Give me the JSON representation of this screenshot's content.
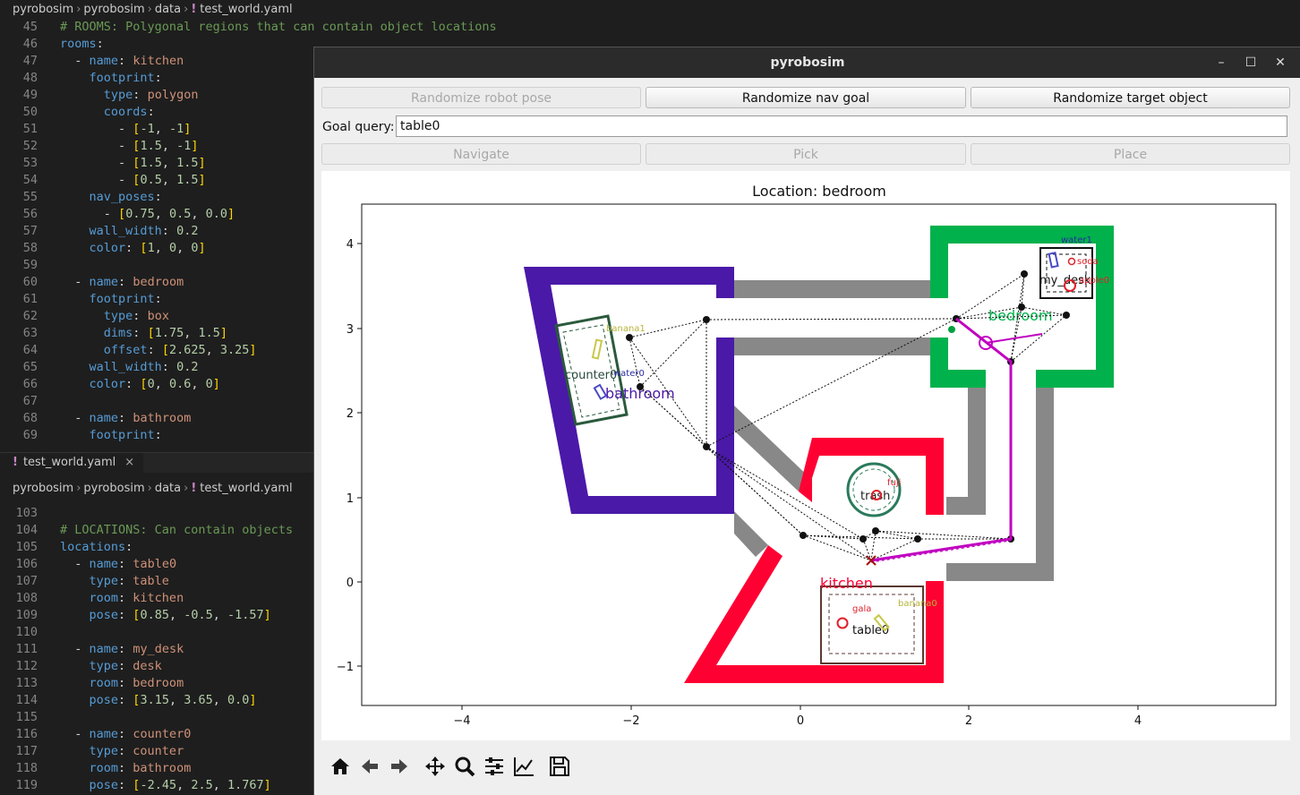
{
  "editor_top": {
    "breadcrumb": [
      "pyrobosim",
      "pyrobosim",
      "data",
      "test_world.yaml"
    ],
    "lines": [
      {
        "n": "45",
        "h": "<span class='c'># ROOMS: Polygonal regions that can contain object locations</span>"
      },
      {
        "n": "46",
        "h": "<span class='k'>rooms</span><span class='p'>:</span>"
      },
      {
        "n": "47",
        "h": "  <span class='p'>- </span><span class='k'>name</span><span class='p'>: </span><span class='v'>kitchen</span>"
      },
      {
        "n": "48",
        "h": "    <span class='k'>footprint</span><span class='p'>:</span>"
      },
      {
        "n": "49",
        "h": "      <span class='k'>type</span><span class='p'>: </span><span class='v'>polygon</span>"
      },
      {
        "n": "50",
        "h": "      <span class='k'>coords</span><span class='p'>:</span>"
      },
      {
        "n": "51",
        "h": "        <span class='p'>- </span><span class='y'>[</span><span class='n'>-1</span><span class='p'>, </span><span class='n'>-1</span><span class='y'>]</span>"
      },
      {
        "n": "52",
        "h": "        <span class='p'>- </span><span class='y'>[</span><span class='n'>1.5</span><span class='p'>, </span><span class='n'>-1</span><span class='y'>]</span>"
      },
      {
        "n": "53",
        "h": "        <span class='p'>- </span><span class='y'>[</span><span class='n'>1.5</span><span class='p'>, </span><span class='n'>1.5</span><span class='y'>]</span>"
      },
      {
        "n": "54",
        "h": "        <span class='p'>- </span><span class='y'>[</span><span class='n'>0.5</span><span class='p'>, </span><span class='n'>1.5</span><span class='y'>]</span>"
      },
      {
        "n": "55",
        "h": "    <span class='k'>nav_poses</span><span class='p'>:</span>"
      },
      {
        "n": "56",
        "h": "      <span class='p'>- </span><span class='y'>[</span><span class='n'>0.75</span><span class='p'>, </span><span class='n'>0.5</span><span class='p'>, </span><span class='n'>0.0</span><span class='y'>]</span>"
      },
      {
        "n": "57",
        "h": "    <span class='k'>wall_width</span><span class='p'>: </span><span class='n'>0.2</span>"
      },
      {
        "n": "58",
        "h": "    <span class='k'>color</span><span class='p'>: </span><span class='y'>[</span><span class='n'>1</span><span class='p'>, </span><span class='n'>0</span><span class='p'>, </span><span class='n'>0</span><span class='y'>]</span>"
      },
      {
        "n": "59",
        "h": ""
      },
      {
        "n": "60",
        "h": "  <span class='p'>- </span><span class='k'>name</span><span class='p'>: </span><span class='v'>bedroom</span>"
      },
      {
        "n": "61",
        "h": "    <span class='k'>footprint</span><span class='p'>:</span>"
      },
      {
        "n": "62",
        "h": "      <span class='k'>type</span><span class='p'>: </span><span class='v'>box</span>"
      },
      {
        "n": "63",
        "h": "      <span class='k'>dims</span><span class='p'>: </span><span class='y'>[</span><span class='n'>1.75</span><span class='p'>, </span><span class='n'>1.5</span><span class='y'>]</span>"
      },
      {
        "n": "64",
        "h": "      <span class='k'>offset</span><span class='p'>: </span><span class='y'>[</span><span class='n'>2.625</span><span class='p'>, </span><span class='n'>3.25</span><span class='y'>]</span>"
      },
      {
        "n": "65",
        "h": "    <span class='k'>wall_width</span><span class='p'>: </span><span class='n'>0.2</span>"
      },
      {
        "n": "66",
        "h": "    <span class='k'>color</span><span class='p'>: </span><span class='y'>[</span><span class='n'>0</span><span class='p'>, </span><span class='n'>0.6</span><span class='p'>, </span><span class='n'>0</span><span class='y'>]</span>"
      },
      {
        "n": "67",
        "h": ""
      },
      {
        "n": "68",
        "h": "  <span class='p'>- </span><span class='k'>name</span><span class='p'>: </span><span class='v'>bathroom</span>"
      },
      {
        "n": "69",
        "h": "    <span class='k'>footprint</span><span class='p'>:</span>"
      }
    ]
  },
  "tab": {
    "label": "test_world.yaml",
    "close": "×"
  },
  "editor_bottom": {
    "breadcrumb": [
      "pyrobosim",
      "pyrobosim",
      "data",
      "test_world.yaml"
    ],
    "lines": [
      {
        "n": "103",
        "h": ""
      },
      {
        "n": "104",
        "h": "<span class='c'># LOCATIONS: Can contain objects</span>"
      },
      {
        "n": "105",
        "h": "<span class='k'>locations</span><span class='p'>:</span>"
      },
      {
        "n": "106",
        "h": "  <span class='p'>- </span><span class='k'>name</span><span class='p'>: </span><span class='v'>table0</span>"
      },
      {
        "n": "107",
        "h": "    <span class='k'>type</span><span class='p'>: </span><span class='v'>table</span>"
      },
      {
        "n": "108",
        "h": "    <span class='k'>room</span><span class='p'>: </span><span class='v'>kitchen</span>"
      },
      {
        "n": "109",
        "h": "    <span class='k'>pose</span><span class='p'>: </span><span class='y'>[</span><span class='n'>0.85</span><span class='p'>, </span><span class='n'>-0.5</span><span class='p'>, </span><span class='n'>-1.57</span><span class='y'>]</span>"
      },
      {
        "n": "110",
        "h": ""
      },
      {
        "n": "111",
        "h": "  <span class='p'>- </span><span class='k'>name</span><span class='p'>: </span><span class='v'>my_desk</span>"
      },
      {
        "n": "112",
        "h": "    <span class='k'>type</span><span class='p'>: </span><span class='v'>desk</span>"
      },
      {
        "n": "113",
        "h": "    <span class='k'>room</span><span class='p'>: </span><span class='v'>bedroom</span>"
      },
      {
        "n": "114",
        "h": "    <span class='k'>pose</span><span class='p'>: </span><span class='y'>[</span><span class='n'>3.15</span><span class='p'>, </span><span class='n'>3.65</span><span class='p'>, </span><span class='n'>0.0</span><span class='y'>]</span>"
      },
      {
        "n": "115",
        "h": ""
      },
      {
        "n": "116",
        "h": "  <span class='p'>- </span><span class='k'>name</span><span class='p'>: </span><span class='v'>counter0</span>"
      },
      {
        "n": "117",
        "h": "    <span class='k'>type</span><span class='p'>: </span><span class='v'>counter</span>"
      },
      {
        "n": "118",
        "h": "    <span class='k'>room</span><span class='p'>: </span><span class='v'>bathroom</span>"
      },
      {
        "n": "119",
        "h": "    <span class='k'>pose</span><span class='p'>: </span><span class='y'>[</span><span class='n'>-2.45</span><span class='p'>, </span><span class='n'>2.5</span><span class='p'>, </span><span class='n'>1.767</span><span class='y'>]</span>"
      }
    ]
  },
  "window": {
    "title": "pyrobosim",
    "controls": {
      "minimize": "–",
      "maximize": "☐",
      "close": "✕"
    },
    "buttons": {
      "randomize_robot_pose": "Randomize robot pose",
      "randomize_nav_goal": "Randomize nav goal",
      "randomize_target_object": "Randomize target object",
      "navigate": "Navigate",
      "pick": "Pick",
      "place": "Place"
    },
    "goal_query_label": "Goal query:",
    "goal_query_value": "table0"
  },
  "plot": {
    "title": "Location: bedroom",
    "x_ticks": [
      "−4",
      "−2",
      "0",
      "2",
      "4"
    ],
    "y_ticks": [
      "4",
      "3",
      "2",
      "1",
      "0",
      "−1"
    ],
    "rooms": {
      "kitchen": "kitchen",
      "bedroom": "bedroom",
      "bathroom": "bathroom"
    },
    "locations": {
      "table0": "table0",
      "my_desk": "my_desk",
      "counter0": "counter0",
      "trash": "trash"
    },
    "objects": {
      "banana1": "banana1",
      "water0": "water0",
      "water1": "water1",
      "soda": "soda",
      "apple0": "apple0",
      "fuji": "fuji",
      "gala": "gala",
      "banana0": "banana0"
    },
    "colors": {
      "kitchen": "#ff0033",
      "bedroom": "#00b14c",
      "bathroom": "#4a19a8",
      "hallway": "#8a8a8a",
      "path": "#c000c0"
    }
  },
  "toolbar": [
    "home-icon",
    "back-icon",
    "forward-icon",
    "pan-icon",
    "zoom-icon",
    "configure-icon",
    "axes-icon",
    "save-icon"
  ]
}
